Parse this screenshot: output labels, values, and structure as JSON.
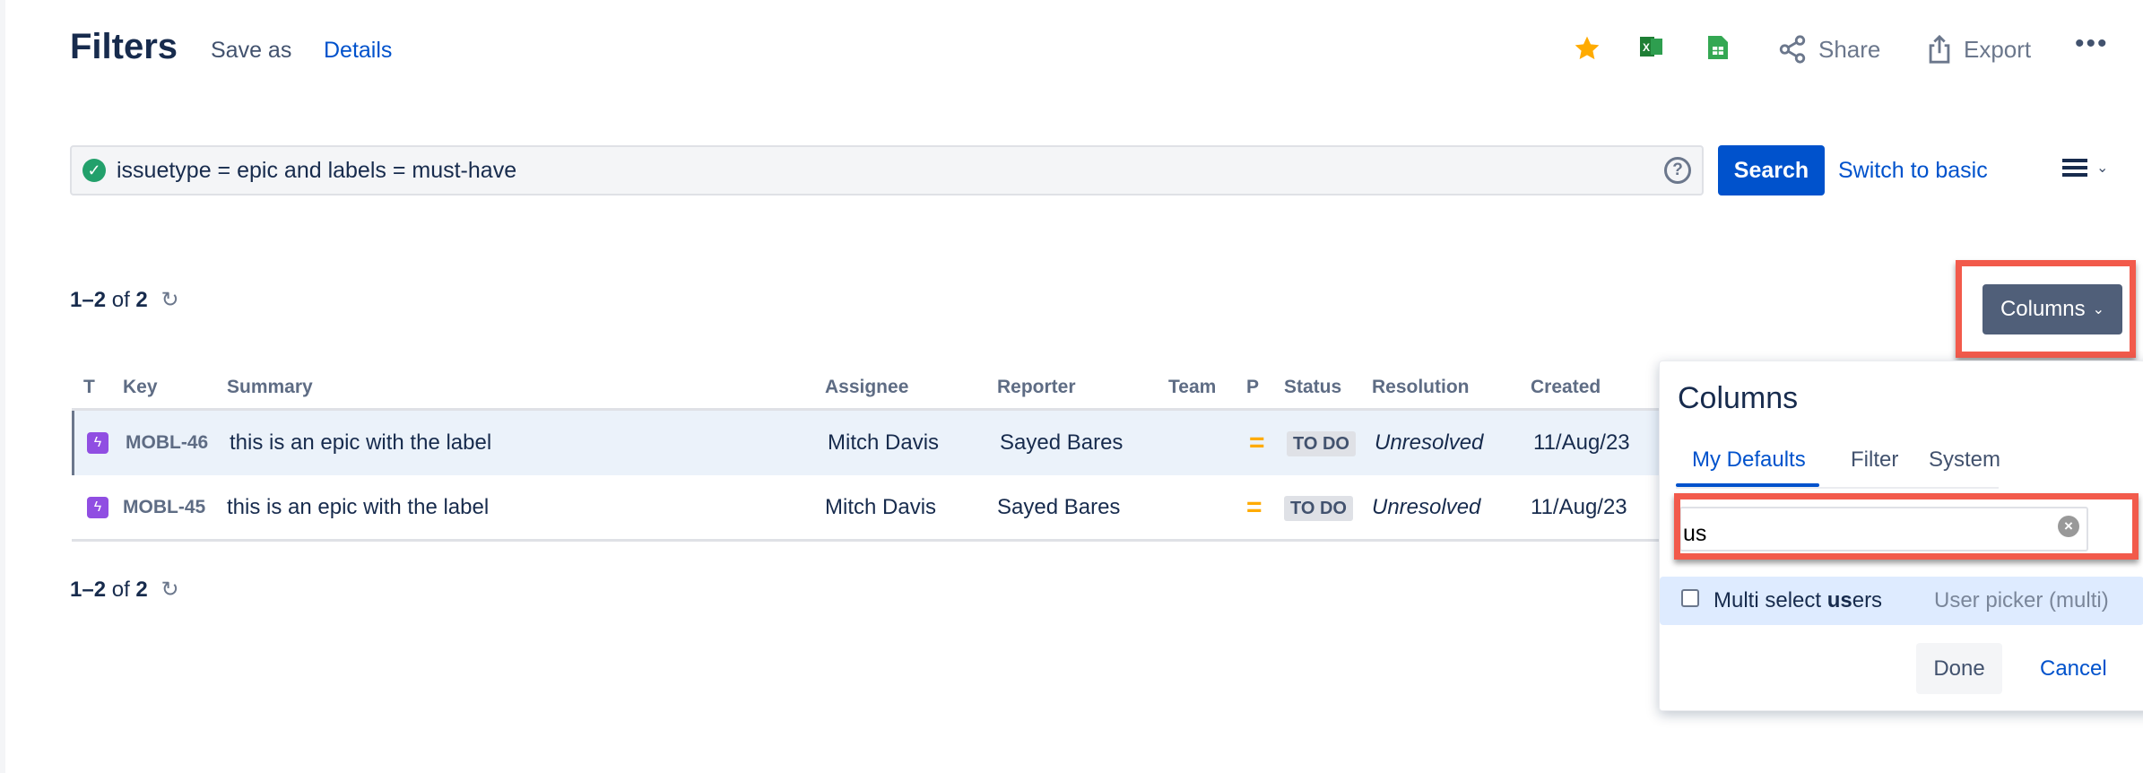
{
  "header": {
    "title": "Filters",
    "save_as": "Save as",
    "details": "Details",
    "share": "Share",
    "export": "Export"
  },
  "search": {
    "query": "issuetype = epic and labels = must-have",
    "help": "?",
    "search_button": "Search",
    "switch_mode": "Switch to basic"
  },
  "results": {
    "count_range": "1–2",
    "count_of": "of",
    "count_total": "2",
    "columns_button": "Columns"
  },
  "table": {
    "headers": [
      "T",
      "Key",
      "Summary",
      "Assignee",
      "Reporter",
      "Team",
      "P",
      "Status",
      "Resolution",
      "Created"
    ],
    "rows": [
      {
        "key": "MOBL-46",
        "summary": "this is an epic with the label",
        "assignee": "Mitch Davis",
        "reporter": "Sayed Bares",
        "team": "",
        "priority": "=",
        "status": "TO DO",
        "resolution": "Unresolved",
        "created": "11/Aug/23"
      },
      {
        "key": "MOBL-45",
        "summary": "this is an epic with the label",
        "assignee": "Mitch Davis",
        "reporter": "Sayed Bares",
        "team": "",
        "priority": "=",
        "status": "TO DO",
        "resolution": "Unresolved",
        "created": "11/Aug/23"
      }
    ]
  },
  "columns_popup": {
    "title": "Columns",
    "tabs": [
      "My Defaults",
      "Filter",
      "System"
    ],
    "search_value": "us",
    "option": {
      "label_prefix": "Multi select ",
      "label_match": "us",
      "label_suffix": "ers",
      "type": "User picker (multi)"
    },
    "done": "Done",
    "cancel": "Cancel"
  },
  "colors": {
    "accent": "#0052cc",
    "highlight": "#f25a4b",
    "epic": "#904ee2"
  }
}
